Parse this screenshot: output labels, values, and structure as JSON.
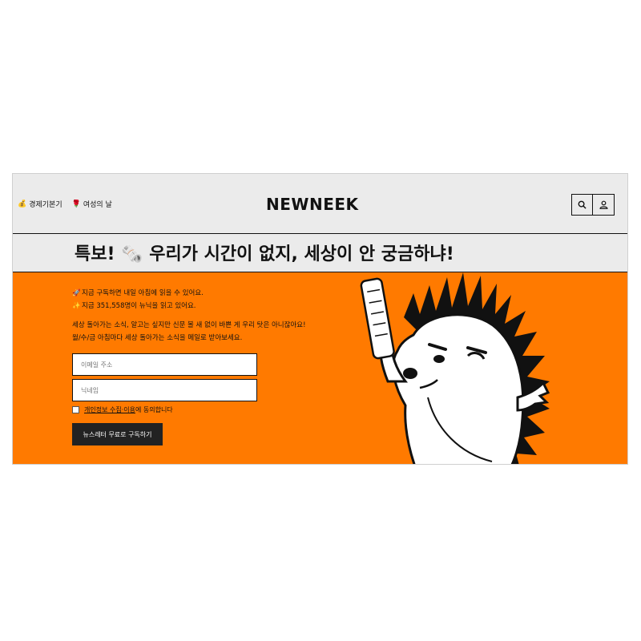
{
  "nav": {
    "items": [
      {
        "icon": "money-bag-icon",
        "emoji": "💰",
        "label": "경제기본기"
      },
      {
        "icon": "rose-icon",
        "emoji": "🌹",
        "label": "여성의 날"
      }
    ]
  },
  "brand": {
    "logo": "NEWNEEK"
  },
  "header_icons": [
    "search-icon",
    "user-icon"
  ],
  "headline": {
    "text": "특보! 🗞️ 우리가 시간이 없지, 세상이 안 궁금하냐!"
  },
  "hero": {
    "line1_emoji": "🚀",
    "line1": "지금 구독하면 내일 아침에 읽을 수 있어요.",
    "line2_emoji": "✨",
    "line2": "지금 351,558명이 뉴닉을 읽고 있어요.",
    "desc1": "세상 돌아가는 소식, 알고는 싶지만 신문 볼 새 없이 바쁜 게 우리 탓은 아니잖아요!",
    "desc2": "월/수/금 아침마다 세상 돌아가는 소식을 메일로 받아보세요.",
    "email_placeholder": "이메일 주소",
    "nickname_placeholder": "닉네임",
    "consent_link": "개인정보 수집·이용",
    "consent_rest": "에 동의합니다",
    "submit_label": "뉴스레터 무료로 구독하기"
  },
  "colors": {
    "accent": "#ff7a00",
    "header_bg": "#ebebeb",
    "button_bg": "#222222"
  }
}
